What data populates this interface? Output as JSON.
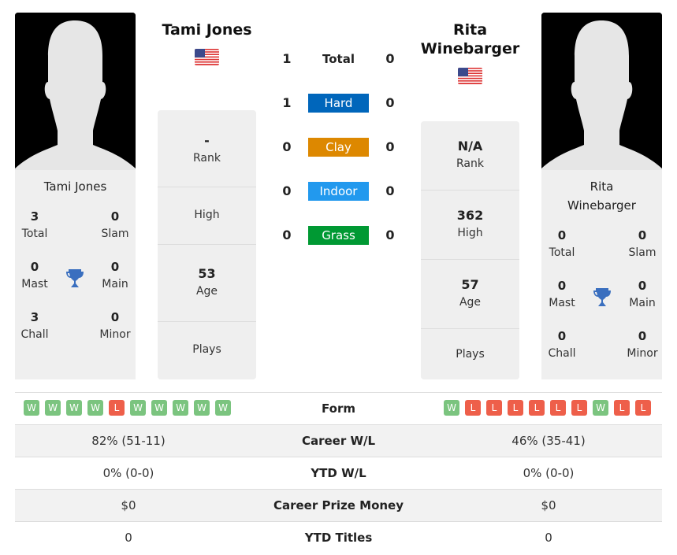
{
  "player1": {
    "name": "Tami Jones",
    "flag": "us-flag-icon",
    "titles": [
      {
        "value": "3",
        "label": "Total"
      },
      {
        "value": "0",
        "label": "Slam"
      },
      {
        "value": "0",
        "label": "Mast"
      },
      {
        "value": "0",
        "label": "Main"
      },
      {
        "value": "3",
        "label": "Chall"
      },
      {
        "value": "0",
        "label": "Minor"
      }
    ],
    "rank": {
      "value": "-",
      "label": "Rank"
    },
    "high": {
      "value": "",
      "label": "High"
    },
    "age": {
      "value": "53",
      "label": "Age"
    },
    "plays": {
      "value": "",
      "label": "Plays"
    },
    "form": [
      "W",
      "W",
      "W",
      "W",
      "L",
      "W",
      "W",
      "W",
      "W",
      "W"
    ],
    "career_wl": "82% (51-11)",
    "ytd_wl": "0% (0-0)",
    "prize": "$0",
    "ytd_titles": "0"
  },
  "player2": {
    "name_line1": "Rita",
    "name_line2": "Winebarger",
    "flag": "us-flag-icon",
    "titles": [
      {
        "value": "0",
        "label": "Total"
      },
      {
        "value": "0",
        "label": "Slam"
      },
      {
        "value": "0",
        "label": "Mast"
      },
      {
        "value": "0",
        "label": "Main"
      },
      {
        "value": "0",
        "label": "Chall"
      },
      {
        "value": "0",
        "label": "Minor"
      }
    ],
    "rank": {
      "value": "N/A",
      "label": "Rank"
    },
    "high": {
      "value": "362",
      "label": "High"
    },
    "age": {
      "value": "57",
      "label": "Age"
    },
    "plays": {
      "value": "",
      "label": "Plays"
    },
    "form": [
      "W",
      "L",
      "L",
      "L",
      "L",
      "L",
      "L",
      "W",
      "L",
      "L"
    ],
    "career_wl": "46% (35-41)",
    "ytd_wl": "0% (0-0)",
    "prize": "$0",
    "ytd_titles": "0"
  },
  "h2h": [
    {
      "label": "Total",
      "p1": "1",
      "p2": "0",
      "color": ""
    },
    {
      "label": "Hard",
      "p1": "1",
      "p2": "0",
      "color": "#0066bb"
    },
    {
      "label": "Clay",
      "p1": "0",
      "p2": "0",
      "color": "#dd8800"
    },
    {
      "label": "Indoor",
      "p1": "0",
      "p2": "0",
      "color": "#2299ee"
    },
    {
      "label": "Grass",
      "p1": "0",
      "p2": "0",
      "color": "#009933"
    }
  ],
  "stats_labels": {
    "form": "Form",
    "career_wl": "Career W/L",
    "ytd_wl": "YTD W/L",
    "prize": "Career Prize Money",
    "ytd_titles": "YTD Titles"
  }
}
